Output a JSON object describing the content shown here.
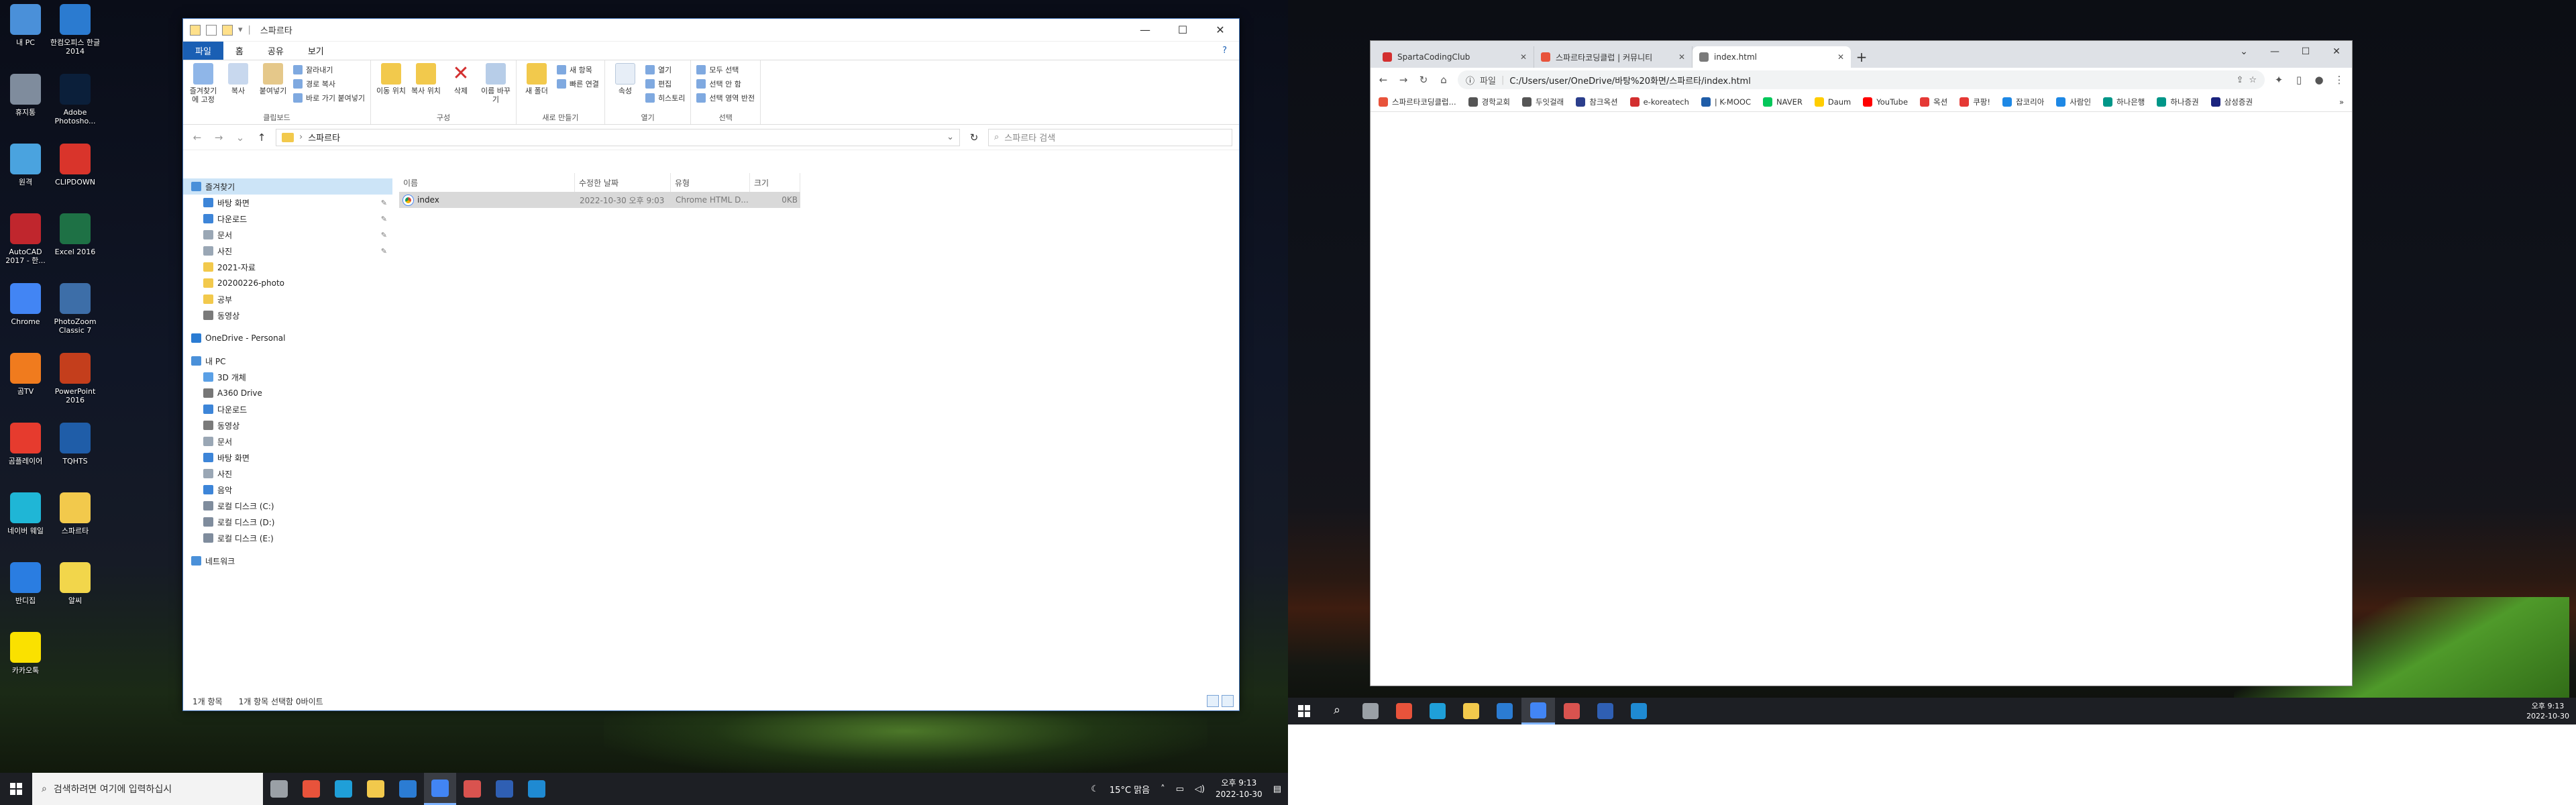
{
  "desktop_icons": [
    {
      "label": "내 PC",
      "icon": "computer-icon",
      "color": "#4a90d9"
    },
    {
      "label": "한컴오피스 한글 2014",
      "icon": "hwp-icon",
      "color": "#2b7bd0"
    },
    {
      "label": "휴지통",
      "icon": "recycle-bin-icon",
      "color": "#7f8c9d"
    },
    {
      "label": "Adobe Photosho...",
      "icon": "photoshop-icon",
      "color": "#0b1f3a"
    },
    {
      "label": "원격",
      "icon": "remote-icon",
      "color": "#4aa3df"
    },
    {
      "label": "CLIPDOWN",
      "icon": "clipdown-icon",
      "color": "#d9342b"
    },
    {
      "label": "AutoCAD 2017 - 한...",
      "icon": "autocad-icon",
      "color": "#c0262d"
    },
    {
      "label": "Excel 2016",
      "icon": "excel-icon",
      "color": "#1e7145"
    },
    {
      "label": "Chrome",
      "icon": "chrome-icon",
      "color": "#4285f4"
    },
    {
      "label": "PhotoZoom Classic 7",
      "icon": "photozoom-icon",
      "color": "#3d6ea8"
    },
    {
      "label": "곰TV",
      "icon": "gomtv-icon",
      "color": "#f07b1e"
    },
    {
      "label": "PowerPoint 2016",
      "icon": "powerpoint-icon",
      "color": "#c43e1c"
    },
    {
      "label": "곰플레이어",
      "icon": "gomplayer-icon",
      "color": "#e63b2e"
    },
    {
      "label": "TQHTS",
      "icon": "tqhts-icon",
      "color": "#1f5da8"
    },
    {
      "label": "네이버 웨일",
      "icon": "whale-icon",
      "color": "#1fb6d6"
    },
    {
      "label": "스파르타",
      "icon": "folder-icon",
      "color": "#f2c94c"
    },
    {
      "label": "반디집",
      "icon": "bandizip-icon",
      "color": "#2a7de1"
    },
    {
      "label": "알씨",
      "icon": "alsee-icon",
      "color": "#f2d64b"
    },
    {
      "label": "카카오톡",
      "icon": "kakaotalk-icon",
      "color": "#fae100"
    }
  ],
  "explorer": {
    "title": "스파르타",
    "ribbon_tabs": [
      "파일",
      "홈",
      "공유",
      "보기"
    ],
    "groups": {
      "clipboard": {
        "name": "클립보드",
        "large": [
          "즐겨찾기에 고정",
          "복사",
          "붙여넣기"
        ],
        "small": [
          "잘라내기",
          "경로 복사",
          "바로 가기 붙여넣기"
        ]
      },
      "organize": {
        "name": "구성",
        "large": [
          "이동 위치",
          "복사 위치",
          "삭제",
          "이름 바꾸기"
        ]
      },
      "new": {
        "name": "새로 만들기",
        "large": [
          "새 폴더"
        ],
        "small": [
          "새 항목",
          "빠른 연결"
        ]
      },
      "open": {
        "name": "열기",
        "large": [
          "속성"
        ],
        "small": [
          "열기",
          "편집",
          "히스토리"
        ]
      },
      "select": {
        "name": "선택",
        "small": [
          "모두 선택",
          "선택 안 함",
          "선택 영역 반전"
        ]
      }
    },
    "address": "스파르타",
    "search_placeholder": "스파르타 검색",
    "nav_items": [
      {
        "label": "즐겨찾기",
        "color": "#4a90d9",
        "pinned": false,
        "indent": 0,
        "selected": true
      },
      {
        "label": "바탕 화면",
        "color": "#3d85d8",
        "pinned": true,
        "indent": 1
      },
      {
        "label": "다운로드",
        "color": "#3d85d8",
        "pinned": true,
        "indent": 1
      },
      {
        "label": "문서",
        "color": "#9aa7b5",
        "pinned": true,
        "indent": 1
      },
      {
        "label": "사진",
        "color": "#9aa7b5",
        "pinned": true,
        "indent": 1
      },
      {
        "label": "2021-자료",
        "color": "#f2c94c",
        "pinned": false,
        "indent": 1
      },
      {
        "label": "20200226-photo",
        "color": "#f2c94c",
        "pinned": false,
        "indent": 1
      },
      {
        "label": "공부",
        "color": "#f2c94c",
        "pinned": false,
        "indent": 1
      },
      {
        "label": "동영상",
        "color": "#7a7a7a",
        "pinned": false,
        "indent": 1
      },
      {
        "label": "",
        "color": "",
        "pinned": false,
        "indent": 0,
        "spacer": true
      },
      {
        "label": "OneDrive - Personal",
        "color": "#2b7cd3",
        "pinned": false,
        "indent": 0
      },
      {
        "label": "",
        "color": "",
        "pinned": false,
        "indent": 0,
        "spacer": true
      },
      {
        "label": "내 PC",
        "color": "#4a90d9",
        "pinned": false,
        "indent": 0
      },
      {
        "label": "3D 개체",
        "color": "#5aa0e6",
        "pinned": false,
        "indent": 1
      },
      {
        "label": "A360 Drive",
        "color": "#777777",
        "pinned": false,
        "indent": 1
      },
      {
        "label": "다운로드",
        "color": "#3d85d8",
        "pinned": false,
        "indent": 1
      },
      {
        "label": "동영상",
        "color": "#7a7a7a",
        "pinned": false,
        "indent": 1
      },
      {
        "label": "문서",
        "color": "#9aa7b5",
        "pinned": false,
        "indent": 1
      },
      {
        "label": "바탕 화면",
        "color": "#3d85d8",
        "pinned": false,
        "indent": 1
      },
      {
        "label": "사진",
        "color": "#9aa7b5",
        "pinned": false,
        "indent": 1
      },
      {
        "label": "음악",
        "color": "#3d85d8",
        "pinned": false,
        "indent": 1
      },
      {
        "label": "로컬 디스크 (C:)",
        "color": "#7f8c9d",
        "pinned": false,
        "indent": 1
      },
      {
        "label": "로컬 디스크 (D:)",
        "color": "#7f8c9d",
        "pinned": false,
        "indent": 1
      },
      {
        "label": "로컬 디스크 (E:)",
        "color": "#7f8c9d",
        "pinned": false,
        "indent": 1
      },
      {
        "label": "",
        "color": "",
        "pinned": false,
        "indent": 0,
        "spacer": true
      },
      {
        "label": "네트워크",
        "color": "#4a90d9",
        "pinned": false,
        "indent": 0
      }
    ],
    "columns": [
      "이름",
      "수정한 날짜",
      "유형",
      "크기"
    ],
    "files": [
      {
        "name": "index",
        "modified": "2022-10-30 오후 9:03",
        "type": "Chrome HTML D...",
        "size": "0KB"
      }
    ],
    "status": {
      "count": "1개 항목",
      "selected": "1개 항목 선택함 0바이트"
    }
  },
  "taskbar_left": {
    "search_placeholder": "검색하려면 여기에 입력하십시",
    "weather": "15°C 맑음",
    "time": "오후 9:13",
    "date": "2022-10-30",
    "apps": [
      {
        "icon": "task-view-icon",
        "color": "#9aa0a6",
        "active": false
      },
      {
        "icon": "sparta-app-icon",
        "color": "#e8533b",
        "active": false
      },
      {
        "icon": "edge-icon",
        "color": "#1f9fd8",
        "active": false
      },
      {
        "icon": "file-explorer-icon",
        "color": "#f2c94c",
        "active": false
      },
      {
        "icon": "mail-icon",
        "color": "#2b7cd3",
        "active": false
      },
      {
        "icon": "chrome-icon",
        "color": "#4285f4",
        "active": true
      },
      {
        "icon": "python-icon",
        "color": "#d9534f",
        "active": false
      },
      {
        "icon": "photoshop-icon",
        "color": "#2f5fb3",
        "active": false
      },
      {
        "icon": "vscode-icon",
        "color": "#1f8ad2",
        "active": false
      }
    ]
  },
  "browser": {
    "tabs": [
      {
        "title": "SpartaCodingClub",
        "color": "#d32f2f",
        "active": false
      },
      {
        "title": "스파르타코딩클럽 | 커뮤니티",
        "color": "#e8533b",
        "active": false
      },
      {
        "title": "index.html",
        "color": "#7a7a7a",
        "active": true
      }
    ],
    "omnibox_label": "파일",
    "url": "C:/Users/user/OneDrive/바탕%20화면/스파르타/index.html",
    "bookmarks": [
      {
        "label": "스파르타코딩클럽...",
        "color": "#e8533b"
      },
      {
        "label": "경학교회",
        "color": "#555555"
      },
      {
        "label": "두잇걸래",
        "color": "#555555"
      },
      {
        "label": "참크옥션",
        "color": "#2b3e8c"
      },
      {
        "label": "e-koreatech",
        "color": "#d32f2f"
      },
      {
        "label": "| K-MOOC",
        "color": "#1f5da8"
      },
      {
        "label": "NAVER",
        "color": "#03c75a"
      },
      {
        "label": "Daum",
        "color": "#ffcd00"
      },
      {
        "label": "YouTube",
        "color": "#ff0000"
      },
      {
        "label": "옥션",
        "color": "#e53935"
      },
      {
        "label": "쿠팡!",
        "color": "#e53935"
      },
      {
        "label": "잡코리아",
        "color": "#1e88e5"
      },
      {
        "label": "사람인",
        "color": "#1e88e5"
      },
      {
        "label": "하나은행",
        "color": "#009688"
      },
      {
        "label": "하나증권",
        "color": "#009688"
      },
      {
        "label": "삼성증권",
        "color": "#1a237e"
      }
    ]
  },
  "taskbar_right": {
    "time": "오후 9:13",
    "date": "2022-10-30",
    "apps": [
      {
        "icon": "search-icon",
        "color": "#ffffff",
        "active": false
      },
      {
        "icon": "task-view-icon",
        "color": "#9aa0a6",
        "active": false
      },
      {
        "icon": "sparta-app-icon",
        "color": "#e8533b",
        "active": false
      },
      {
        "icon": "edge-icon",
        "color": "#1f9fd8",
        "active": false
      },
      {
        "icon": "file-explorer-icon",
        "color": "#f2c94c",
        "active": false
      },
      {
        "icon": "mail-icon",
        "color": "#2b7cd3",
        "active": false
      },
      {
        "icon": "chrome-icon",
        "color": "#4285f4",
        "active": true
      },
      {
        "icon": "python-icon",
        "color": "#d9534f",
        "active": false
      },
      {
        "icon": "photoshop-icon",
        "color": "#2f5fb3",
        "active": false
      },
      {
        "icon": "vscode-icon",
        "color": "#1f8ad2",
        "active": false
      }
    ]
  }
}
